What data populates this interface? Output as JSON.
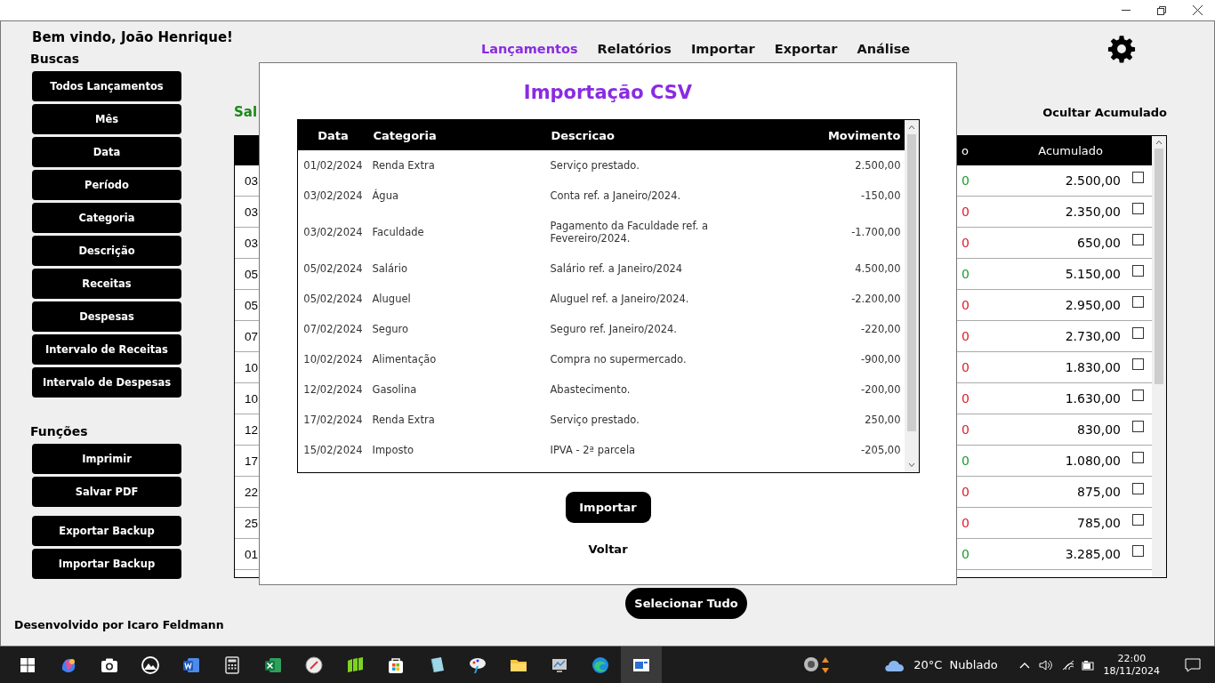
{
  "welcome": "Bem vindo, João Henrique!",
  "sidebar": {
    "search_title": "Buscas",
    "search_buttons": [
      "Todos Lançamentos",
      "Mês",
      "Data",
      "Período",
      "Categoria",
      "Descrição",
      "Receitas",
      "Despesas",
      "Intervalo de Receitas",
      "Intervalo de Despesas"
    ],
    "functions_title": "Funções",
    "function_buttons": [
      [
        "Imprimir",
        "Salvar PDF"
      ],
      [
        "Exportar Backup",
        "Importar Backup"
      ]
    ],
    "footer": "Desenvolvido por Icaro Feldmann"
  },
  "nav": [
    {
      "label": "Lançamentos",
      "selected": true
    },
    {
      "label": "Relatórios",
      "selected": false
    },
    {
      "label": "Importar",
      "selected": false
    },
    {
      "label": "Exportar",
      "selected": false
    },
    {
      "label": "Análise",
      "selected": false
    }
  ],
  "balance_label": "Sal",
  "hide_accumulated": "Ocultar Acumulado",
  "background_table": {
    "columns": [
      "o",
      "Acumulado"
    ],
    "rows": [
      {
        "date": "03",
        "movement": "0",
        "color": "#1e9a2e",
        "accumulated": "2.500,00",
        "checked": false
      },
      {
        "date": "03",
        "movement": "0",
        "color": "#d8202f",
        "accumulated": "2.350,00",
        "checked": false
      },
      {
        "date": "03",
        "movement": "0",
        "color": "#d8202f",
        "accumulated": "650,00",
        "checked": false
      },
      {
        "date": "05",
        "movement": "0",
        "color": "#1e9a2e",
        "accumulated": "5.150,00",
        "checked": false
      },
      {
        "date": "05",
        "movement": "0",
        "color": "#d8202f",
        "accumulated": "2.950,00",
        "checked": false
      },
      {
        "date": "07",
        "movement": "0",
        "color": "#d8202f",
        "accumulated": "2.730,00",
        "checked": false
      },
      {
        "date": "10",
        "movement": "0",
        "color": "#d8202f",
        "accumulated": "1.830,00",
        "checked": false
      },
      {
        "date": "10",
        "movement": "0",
        "color": "#d8202f",
        "accumulated": "1.630,00",
        "checked": false
      },
      {
        "date": "12",
        "movement": "0",
        "color": "#d8202f",
        "accumulated": "830,00",
        "checked": false
      },
      {
        "date": "17",
        "movement": "0",
        "color": "#1e9a2e",
        "accumulated": "1.080,00",
        "checked": false
      },
      {
        "date": "22",
        "movement": "0",
        "color": "#d8202f",
        "accumulated": "875,00",
        "checked": false
      },
      {
        "date": "25",
        "movement": "0",
        "color": "#d8202f",
        "accumulated": "785,00",
        "checked": false
      },
      {
        "date": "01",
        "movement": "0",
        "color": "#1e9a2e",
        "accumulated": "3.285,00",
        "checked": false
      }
    ]
  },
  "select_all": "Selecionar Tudo",
  "modal": {
    "title": "Importação CSV",
    "columns": [
      "Data",
      "Categoria",
      "Descricao",
      "Movimento"
    ],
    "rows": [
      [
        "01/02/2024",
        "Renda Extra",
        "Serviço prestado.",
        "2.500,00"
      ],
      [
        "03/02/2024",
        "Água",
        "Conta ref. a Janeiro/2024.",
        "-150,00"
      ],
      [
        "03/02/2024",
        "Faculdade",
        "Pagamento da Faculdade ref.  a Fevereiro/2024.",
        "-1.700,00"
      ],
      [
        "05/02/2024",
        "Salário",
        "Salário ref. a Janeiro/2024",
        "4.500,00"
      ],
      [
        "05/02/2024",
        "Aluguel",
        "Aluguel ref. a Janeiro/2024.",
        "-2.200,00"
      ],
      [
        "07/02/2024",
        "Seguro",
        "Seguro ref. Janeiro/2024.",
        "-220,00"
      ],
      [
        "10/02/2024",
        "Alimentação",
        "Compra no supermercado.",
        "-900,00"
      ],
      [
        "12/02/2024",
        "Gasolina",
        "Abastecimento.",
        "-200,00"
      ],
      [
        "17/02/2024",
        "Renda Extra",
        "Serviço prestado.",
        "250,00"
      ],
      [
        "15/02/2024",
        "Imposto",
        "IPVA - 2ª parcela",
        "-205,00"
      ]
    ],
    "import_button": "Importar",
    "back_link": "Voltar"
  },
  "taskbar": {
    "weather": "20°C  Nublado",
    "time": "22:00",
    "date": "18/11/2024"
  }
}
